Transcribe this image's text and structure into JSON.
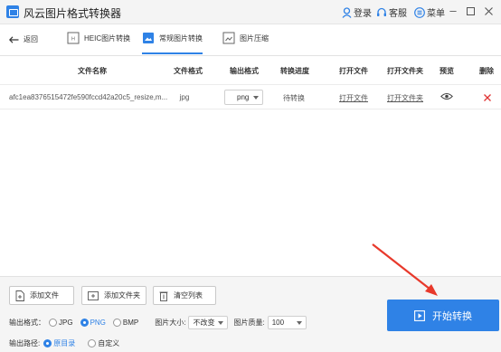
{
  "app": {
    "title": "风云图片格式转换器"
  },
  "titlebar": {
    "login": "登录",
    "service": "客服",
    "menu": "菜单"
  },
  "nav": {
    "back": "返回",
    "tabs": [
      {
        "label": "HEIC图片转换",
        "active": false
      },
      {
        "label": "常规图片转换",
        "active": true
      },
      {
        "label": "图片压缩",
        "active": false
      }
    ]
  },
  "table": {
    "headers": [
      "文件名称",
      "文件格式",
      "输出格式",
      "转换进度",
      "打开文件",
      "打开文件夹",
      "预览",
      "删除"
    ],
    "rows": [
      {
        "filename": "afc1ea8376515472fe590fccd42a20c5_resize,m...",
        "format": "jpg",
        "output": "png",
        "progress": "待转换",
        "open_file": "打开文件",
        "open_folder": "打开文件夹"
      }
    ]
  },
  "bottom": {
    "add_file": "添加文件",
    "add_folder": "添加文件夹",
    "clear_list": "清空列表",
    "output_format_label": "输出格式：",
    "formats": [
      {
        "label": "JPG",
        "selected": false
      },
      {
        "label": "PNG",
        "selected": true
      },
      {
        "label": "BMP",
        "selected": false
      }
    ],
    "size_label": "图片大小:",
    "size_value": "不改变",
    "quality_label": "图片质量:",
    "quality_value": "100",
    "path_label": "输出路径:",
    "path_options": [
      {
        "label": "原目录",
        "selected": true
      },
      {
        "label": "自定义",
        "selected": false
      }
    ],
    "start": "开始转换"
  },
  "colors": {
    "accent": "#2f82e6",
    "delete": "#e03434",
    "annotation": "#e8392b"
  }
}
